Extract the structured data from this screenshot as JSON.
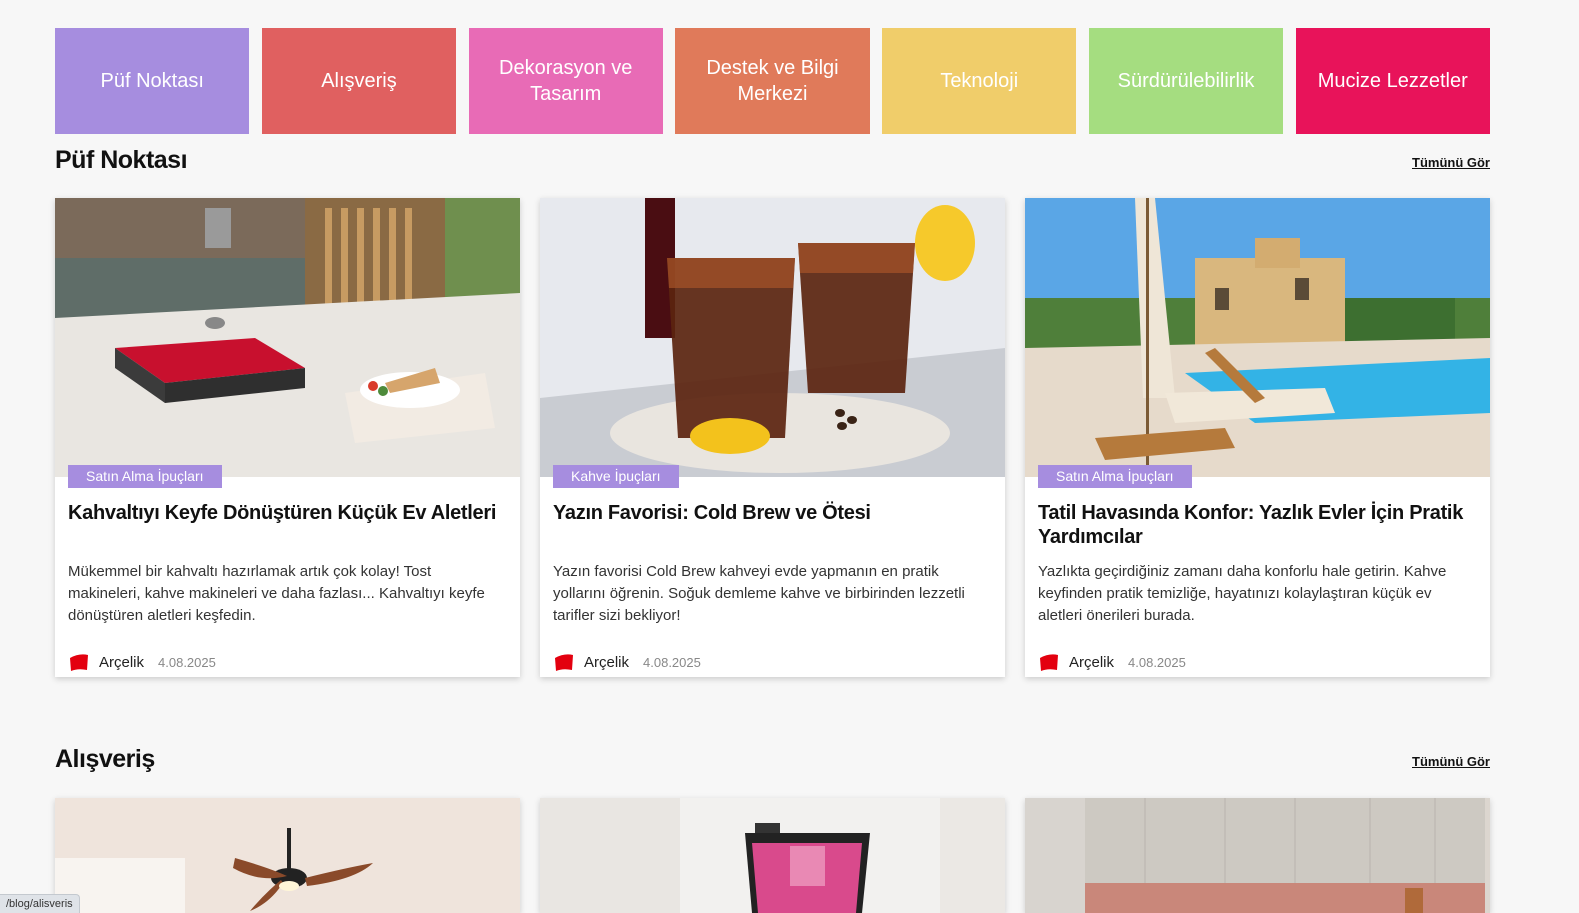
{
  "categories": [
    {
      "label": "Püf Noktası",
      "color": "#a68ddf"
    },
    {
      "label": "Alışveriş",
      "color": "#e06060"
    },
    {
      "label": "Dekorasyon ve Tasarım",
      "color": "#e86bb6"
    },
    {
      "label": "Destek ve Bilgi Merkezi",
      "color": "#e07a5a"
    },
    {
      "label": "Teknoloji",
      "color": "#f0cd6a"
    },
    {
      "label": "Sürdürülebilirlik",
      "color": "#a5dd80"
    },
    {
      "label": "Mucize Lezzetler",
      "color": "#e8135a"
    }
  ],
  "sections": [
    {
      "title": "Püf Noktası",
      "see_all": "Tümünü Gör",
      "cards": [
        {
          "tag": "Satın Alma İpuçları",
          "title": "Kahvaltıyı Keyfe Dönüştüren Küçük Ev Aletleri",
          "description": "Mükemmel bir kahvaltı hazırlamak artık çok kolay! Tost makineleri, kahve makineleri ve daha fazlası... Kahvaltıyı keyfe dönüştüren aletleri keşfedin.",
          "author": "Arçelik",
          "date": "4.08.2025",
          "image": "toaster-breakfast-photo"
        },
        {
          "tag": "Kahve İpuçları",
          "title": "Yazın Favorisi: Cold Brew ve Ötesi",
          "description": "Yazın favorisi Cold Brew kahveyi evde yapmanın en pratik yollarını öğrenin. Soğuk demleme kahve ve birbirinden lezzetli tarifler sizi bekliyor!",
          "author": "Arçelik",
          "date": "4.08.2025",
          "image": "iced-coffee-photo"
        },
        {
          "tag": "Satın Alma İpuçları",
          "title": "Tatil Havasında Konfor: Yazlık Evler İçin Pratik Yardımcılar",
          "description": "Yazlıkta geçirdiğiniz zamanı daha konforlu hale getirin. Kahve keyfinden pratik temizliğe, hayatınızı kolaylaştıran küçük ev aletleri önerileri burada.",
          "author": "Arçelik",
          "date": "4.08.2025",
          "image": "pool-villa-photo"
        }
      ]
    },
    {
      "title": "Alışveriş",
      "see_all": "Tümünü Gör"
    }
  ],
  "status_url": "/blog/alisveris",
  "brand_color": "#e3000f"
}
